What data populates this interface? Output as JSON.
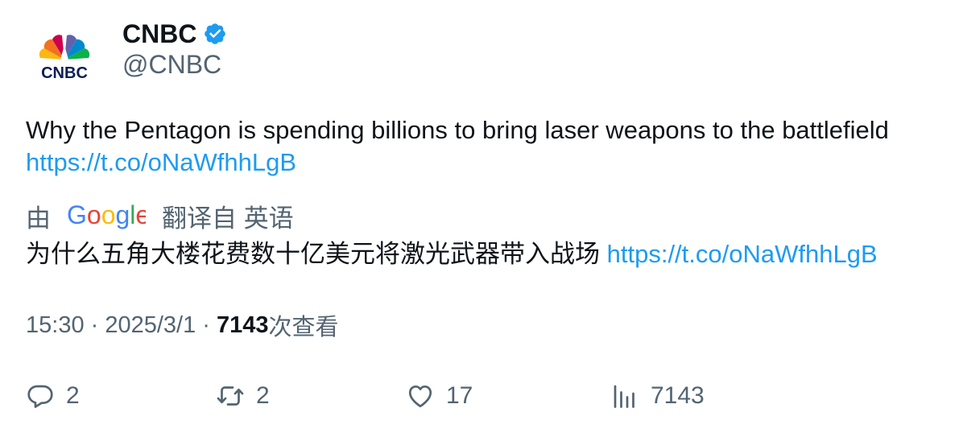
{
  "author": {
    "display_name": "CNBC",
    "handle": "@CNBC",
    "avatar_logo_text": "CNBC",
    "verified": true
  },
  "tweet": {
    "text": "Why the Pentagon is spending billions to bring laser weapons to the battlefield",
    "link": "https://t.co/oNaWfhhLgB"
  },
  "translation": {
    "by_label": "由",
    "provider": "Google",
    "from_label": "翻译自 英语",
    "text": "为什么五角大楼花费数十亿美元将激光武器带入战场",
    "link": "https://t.co/oNaWfhhLgB"
  },
  "meta": {
    "time": "15:30",
    "separator": " · ",
    "date": "2025/3/1",
    "views_count": "7143",
    "views_label": "次查看"
  },
  "actions": {
    "reply_count": "2",
    "retweet_count": "2",
    "like_count": "17",
    "views_count": "7143"
  },
  "colors": {
    "link": "#1d9bf0",
    "secondary_text": "#536471",
    "primary_text": "#0f1419",
    "verified_badge": "#1d9bf0"
  }
}
